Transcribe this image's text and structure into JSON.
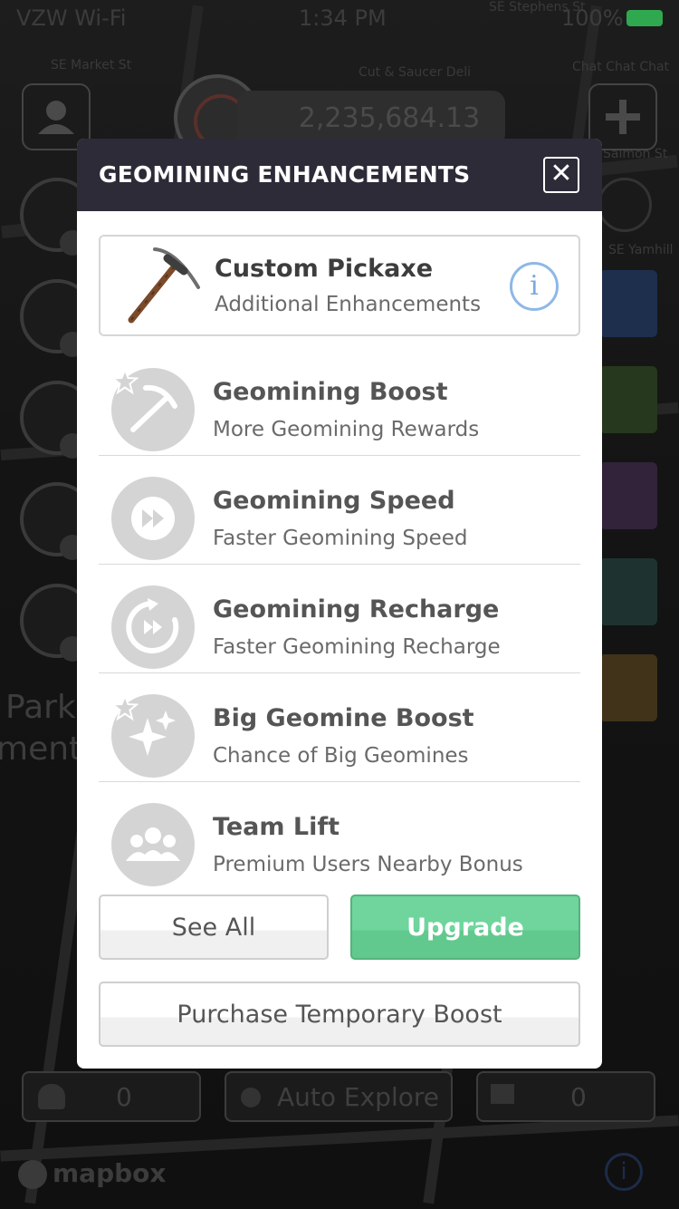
{
  "status_bar": {
    "carrier": "VZW Wi-Fi",
    "time": "1:34 PM",
    "battery_pct": "100%"
  },
  "top": {
    "balance": "2,235,684.13"
  },
  "map": {
    "labels": [
      "SE Market St",
      "Cut & Saucer Deli",
      "Chat Chat Chat",
      "Salmon St",
      "SE Yamhill",
      "SE Stephens St"
    ],
    "park_text": "Park",
    "ments_text": "ments"
  },
  "modal": {
    "title": "GEOMINING ENHANCEMENTS",
    "close_symbol": "✕",
    "featured": {
      "title": "Custom Pickaxe",
      "subtitle": "Additional Enhancements",
      "info_symbol": "i"
    },
    "items": [
      {
        "title": "Geomining Boost",
        "subtitle": "More Geomining Rewards"
      },
      {
        "title": "Geomining Speed",
        "subtitle": "Faster Geomining Speed"
      },
      {
        "title": "Geomining Recharge",
        "subtitle": "Faster Geomining Recharge"
      },
      {
        "title": "Big Geomine Boost",
        "subtitle": "Chance of Big Geomines"
      },
      {
        "title": "Team Lift",
        "subtitle": "Premium Users Nearby Bonus"
      }
    ],
    "buttons": {
      "see_all": "See All",
      "upgrade": "Upgrade",
      "purchase": "Purchase Temporary Boost"
    }
  },
  "bottom_bar": {
    "left_value": "0",
    "auto_explore": "Auto Explore",
    "right_value": "0"
  },
  "footer": {
    "mapbox": "mapbox",
    "info_symbol": "i"
  },
  "colors": {
    "header_bg": "#2d2b38",
    "upgrade_green": "#6fd59d",
    "info_blue": "#7aa9de",
    "icon_gray": "#d4d4d4"
  }
}
